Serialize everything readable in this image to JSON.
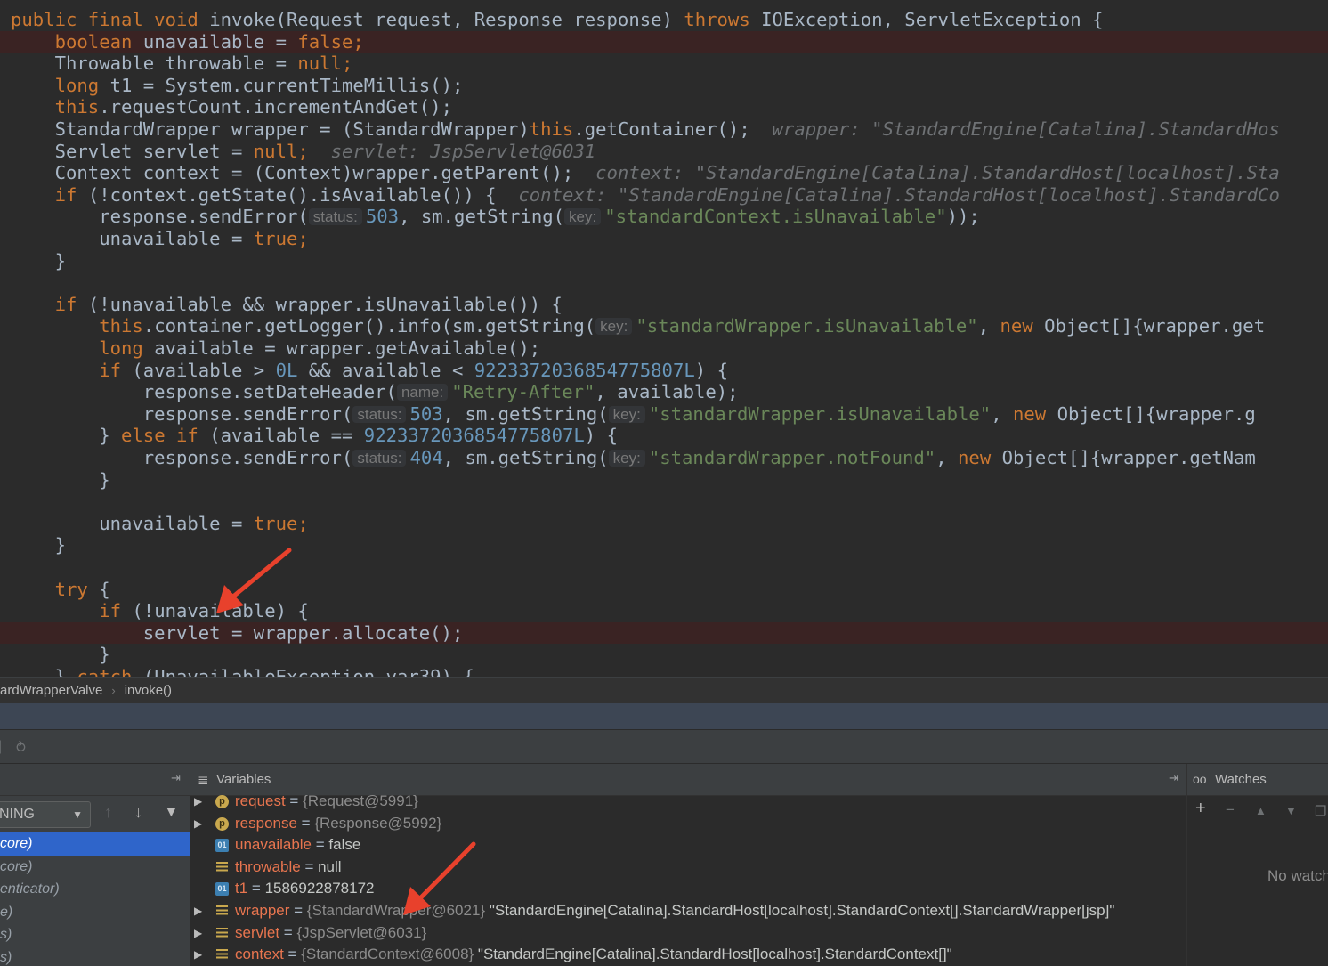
{
  "editor": {
    "lines": [
      {
        "parts": [
          [
            "kw",
            "public final void "
          ],
          [
            "p",
            "invoke(Request request, Response response) "
          ],
          [
            "kw",
            "throws "
          ],
          [
            "p",
            "IOException, ServletException {"
          ]
        ]
      },
      {
        "bp": true,
        "parts": [
          [
            "p",
            "    "
          ],
          [
            "kw",
            "boolean "
          ],
          [
            "p",
            "unavailable = "
          ],
          [
            "kw",
            "false;"
          ]
        ]
      },
      {
        "parts": [
          [
            "p",
            "    Throwable throwable = "
          ],
          [
            "kw",
            "null;"
          ]
        ]
      },
      {
        "parts": [
          [
            "p",
            "    "
          ],
          [
            "kw",
            "long "
          ],
          [
            "p",
            "t1 = System."
          ],
          [
            "p",
            "currentTimeMillis"
          ],
          [
            "p",
            "();"
          ]
        ]
      },
      {
        "parts": [
          [
            "p",
            "    "
          ],
          [
            "kw",
            "this"
          ],
          [
            "p",
            ".requestCount.incrementAndGet();"
          ]
        ]
      },
      {
        "parts": [
          [
            "p",
            "    StandardWrapper wrapper = (StandardWrapper)"
          ],
          [
            "kw",
            "this"
          ],
          [
            "p",
            ".getContainer();  "
          ],
          [
            "inl",
            "wrapper: \"StandardEngine[Catalina].StandardHos"
          ]
        ]
      },
      {
        "parts": [
          [
            "p",
            "    Servlet servlet = "
          ],
          [
            "kw",
            "null;  "
          ],
          [
            "inl",
            "servlet: JspServlet@6031"
          ]
        ]
      },
      {
        "parts": [
          [
            "p",
            "    Context context = (Context)wrapper.getParent();  "
          ],
          [
            "inl",
            "context: \"StandardEngine[Catalina].StandardHost[localhost].Sta"
          ]
        ]
      },
      {
        "parts": [
          [
            "p",
            "    "
          ],
          [
            "kw",
            "if "
          ],
          [
            "p",
            "(!context.getState().isAvailable()) {  "
          ],
          [
            "inl",
            "context: \"StandardEngine[Catalina].StandardHost[localhost].StandardCo"
          ]
        ]
      },
      {
        "parts": [
          [
            "p",
            "        response.sendError("
          ],
          [
            "hint",
            "status:"
          ],
          [
            "num",
            "503"
          ],
          [
            "p",
            ", sm.getString("
          ],
          [
            "hint",
            "key:"
          ],
          [
            "str",
            "\"standardContext.isUnavailable\""
          ],
          [
            "p",
            "));"
          ]
        ]
      },
      {
        "parts": [
          [
            "p",
            "        unavailable = "
          ],
          [
            "kw",
            "true;"
          ]
        ]
      },
      {
        "parts": [
          [
            "p",
            "    }"
          ]
        ]
      },
      {
        "parts": [
          [
            "p",
            ""
          ]
        ]
      },
      {
        "parts": [
          [
            "p",
            "    "
          ],
          [
            "kw",
            "if "
          ],
          [
            "p",
            "(!unavailable && wrapper.isUnavailable()) {"
          ]
        ]
      },
      {
        "parts": [
          [
            "p",
            "        "
          ],
          [
            "kw",
            "this"
          ],
          [
            "p",
            ".container.getLogger().info(sm.getString("
          ],
          [
            "hint",
            "key:"
          ],
          [
            "str",
            "\"standardWrapper.isUnavailable\""
          ],
          [
            "p",
            ", "
          ],
          [
            "kw",
            "new "
          ],
          [
            "p",
            "Object[]{wrapper.get"
          ]
        ]
      },
      {
        "parts": [
          [
            "p",
            "        "
          ],
          [
            "kw",
            "long "
          ],
          [
            "p",
            "available = wrapper.getAvailable();"
          ]
        ]
      },
      {
        "parts": [
          [
            "p",
            "        "
          ],
          [
            "kw",
            "if "
          ],
          [
            "p",
            "(available > "
          ],
          [
            "num",
            "0L "
          ],
          [
            "p",
            "&& available < "
          ],
          [
            "num",
            "9223372036854775807L"
          ],
          [
            "p",
            ") {"
          ]
        ]
      },
      {
        "parts": [
          [
            "p",
            "            response.setDateHeader("
          ],
          [
            "hint",
            "name:"
          ],
          [
            "str",
            "\"Retry-After\""
          ],
          [
            "p",
            ", available);"
          ]
        ]
      },
      {
        "parts": [
          [
            "p",
            "            response.sendError("
          ],
          [
            "hint",
            "status:"
          ],
          [
            "num",
            "503"
          ],
          [
            "p",
            ", sm.getString("
          ],
          [
            "hint",
            "key:"
          ],
          [
            "str",
            "\"standardWrapper.isUnavailable\""
          ],
          [
            "p",
            ", "
          ],
          [
            "kw",
            "new "
          ],
          [
            "p",
            "Object[]{wrapper.g"
          ]
        ]
      },
      {
        "parts": [
          [
            "p",
            "        } "
          ],
          [
            "kw",
            "else if "
          ],
          [
            "p",
            "(available == "
          ],
          [
            "num",
            "9223372036854775807L"
          ],
          [
            "p",
            ") {"
          ]
        ]
      },
      {
        "parts": [
          [
            "p",
            "            response.sendError("
          ],
          [
            "hint",
            "status:"
          ],
          [
            "num",
            "404"
          ],
          [
            "p",
            ", sm.getString("
          ],
          [
            "hint",
            "key:"
          ],
          [
            "str",
            "\"standardWrapper.notFound\""
          ],
          [
            "p",
            ", "
          ],
          [
            "kw",
            "new "
          ],
          [
            "p",
            "Object[]{wrapper.getNam"
          ]
        ]
      },
      {
        "parts": [
          [
            "p",
            "        }"
          ]
        ]
      },
      {
        "parts": [
          [
            "p",
            ""
          ]
        ]
      },
      {
        "parts": [
          [
            "p",
            "        unavailable = "
          ],
          [
            "kw",
            "true;"
          ]
        ]
      },
      {
        "parts": [
          [
            "p",
            "    }"
          ]
        ]
      },
      {
        "parts": [
          [
            "p",
            ""
          ]
        ]
      },
      {
        "parts": [
          [
            "p",
            "    "
          ],
          [
            "kw",
            "try "
          ],
          [
            "p",
            "{"
          ]
        ]
      },
      {
        "parts": [
          [
            "p",
            "        "
          ],
          [
            "kw",
            "if "
          ],
          [
            "p",
            "(!unavailable) {"
          ]
        ]
      },
      {
        "bp": true,
        "parts": [
          [
            "p",
            "            servlet = wrapper.allocate();"
          ]
        ]
      },
      {
        "parts": [
          [
            "p",
            "        }"
          ]
        ]
      },
      {
        "parts": [
          [
            "p",
            "    } "
          ],
          [
            "kw",
            "catch "
          ],
          [
            "p",
            "(UnavailableException var39) {"
          ]
        ]
      }
    ]
  },
  "breadcrumb": {
    "items": [
      "ardWrapperValve",
      "invoke()"
    ],
    "separator": "›"
  },
  "frames": {
    "thread_select": "NING",
    "items": [
      "core)",
      "core)",
      "enticator)",
      "e)",
      "s)",
      "s)"
    ],
    "selected_index": 0
  },
  "variables": {
    "title": "Variables",
    "rows": [
      {
        "expandable": true,
        "icon": "param",
        "icon_text": "p",
        "name": "request",
        "eq": " = ",
        "type": "{Request@5991}",
        "value": ""
      },
      {
        "expandable": true,
        "icon": "param",
        "icon_text": "p",
        "name": "response",
        "eq": " = ",
        "type": "{Response@5992}",
        "value": ""
      },
      {
        "expandable": false,
        "icon": "prim",
        "icon_text": "01",
        "name": "unavailable",
        "eq": " = ",
        "type": "",
        "value": "false"
      },
      {
        "expandable": false,
        "icon": "obj",
        "icon_text": "",
        "name": "throwable",
        "eq": " = ",
        "type": "",
        "value": "null"
      },
      {
        "expandable": false,
        "icon": "prim",
        "icon_text": "01",
        "name": "t1",
        "eq": " = ",
        "type": "",
        "value": "1586922878172"
      },
      {
        "expandable": true,
        "icon": "obj",
        "icon_text": "",
        "name": "wrapper",
        "eq": " = ",
        "type": "{StandardWrapper@6021}",
        "value": " \"StandardEngine[Catalina].StandardHost[localhost].StandardContext[].StandardWrapper[jsp]\""
      },
      {
        "expandable": true,
        "icon": "obj",
        "icon_text": "",
        "name": "servlet",
        "eq": " = ",
        "type": "{JspServlet@6031}",
        "value": ""
      },
      {
        "expandable": true,
        "icon": "obj",
        "icon_text": "",
        "name": "context",
        "eq": " = ",
        "type": "{StandardContext@6008}",
        "value": " \"StandardEngine[Catalina].StandardHost[localhost].StandardContext[]\""
      }
    ]
  },
  "watches": {
    "title": "Watches",
    "empty_text": "No watch"
  },
  "colors": {
    "editor_bg": "#2b2b2b",
    "keyword": "#cc7832",
    "number": "#6897bb",
    "string": "#6a8759",
    "breakpoint_line": "#3a2323",
    "selection": "#2f65ca",
    "annotation_arrow": "#e8412c"
  }
}
